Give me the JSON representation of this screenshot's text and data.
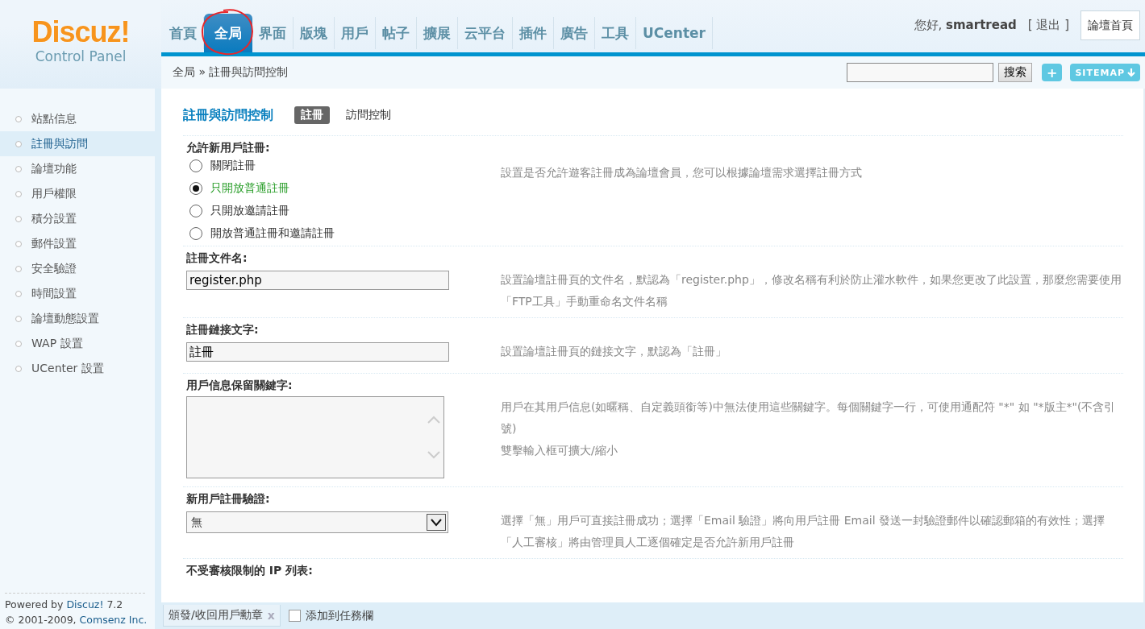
{
  "logo": {
    "name": "Discuz!",
    "subtitle": "Control Panel"
  },
  "nav": [
    {
      "label": "首頁",
      "selected": false
    },
    {
      "label": "全局",
      "selected": true
    },
    {
      "label": "界面",
      "selected": false
    },
    {
      "label": "版塊",
      "selected": false
    },
    {
      "label": "用戶",
      "selected": false
    },
    {
      "label": "帖子",
      "selected": false
    },
    {
      "label": "擴展",
      "selected": false
    },
    {
      "label": "云平台",
      "selected": false
    },
    {
      "label": "插件",
      "selected": false
    },
    {
      "label": "廣告",
      "selected": false
    },
    {
      "label": "工具",
      "selected": false
    },
    {
      "label": "UCenter",
      "selected": false
    }
  ],
  "user": {
    "greeting": "您好, **smartread**",
    "logout": "[ 退出 ]",
    "home_button": "論壇首頁"
  },
  "breadcrumb": {
    "section": "全局",
    "separator": "»",
    "page": "註冊與訪問控制"
  },
  "search": {
    "button": "搜索",
    "add_button": "+",
    "sitemap_button": "SITEMAP"
  },
  "sidebar": {
    "items": [
      {
        "label": "站點信息",
        "selected": false
      },
      {
        "label": "註冊與訪問",
        "selected": true
      },
      {
        "label": "論壇功能",
        "selected": false
      },
      {
        "label": "用戶權限",
        "selected": false
      },
      {
        "label": "積分設置",
        "selected": false
      },
      {
        "label": "郵件設置",
        "selected": false
      },
      {
        "label": "安全驗證",
        "selected": false
      },
      {
        "label": "時間設置",
        "selected": false
      },
      {
        "label": "論壇動態設置",
        "selected": false
      },
      {
        "label": "WAP 設置",
        "selected": false
      },
      {
        "label": "UCenter 設置",
        "selected": false
      }
    ],
    "footer": {
      "powered": "Powered by",
      "product": "Discuz!",
      "version": "7.2",
      "copyright": "© 2001-2009,",
      "company": "Comsenz Inc."
    }
  },
  "page": {
    "title": "註冊與訪問控制",
    "tabs": [
      {
        "label": "註冊",
        "selected": true
      },
      {
        "label": "訪問控制",
        "selected": false
      }
    ]
  },
  "sections": [
    {
      "kind": "radio",
      "label": "允許新用戶註冊:",
      "options": [
        {
          "label": "關閉註冊",
          "selected": false
        },
        {
          "label": "只開放普通註冊",
          "selected": true
        },
        {
          "label": "只開放邀請註冊",
          "selected": false
        },
        {
          "label": "開放普通註冊和邀請註冊",
          "selected": false
        }
      ],
      "description": [
        "設置是否允許遊客註冊成為論壇會員，您可以根據論壇需求選擇註冊方式"
      ]
    },
    {
      "kind": "text",
      "label": "註冊文件名:",
      "value": "register.php",
      "description": [
        "設置論壇註冊頁的文件名，默認為「register.php」，修改名稱有利於防止灌水軟件，如果您更改了此設置，那麼您需要使用「FTP工具」手動重命名文件名稱"
      ]
    },
    {
      "kind": "text",
      "label": "註冊鏈接文字:",
      "value": "註冊",
      "description": [
        "設置論壇註冊頁的鏈接文字，默認為「註冊」"
      ]
    },
    {
      "kind": "textarea",
      "label": "用戶信息保留關鍵字:",
      "description": [
        "用戶在其用戶信息(如暱稱、自定義頭銜等)中無法使用這些關鍵字。每個關鍵字一行，可使用通配符 \"*\" 如 \"*版主*\"(不含引號)",
        "雙擊輸入框可擴大/縮小"
      ]
    },
    {
      "kind": "select",
      "label": "新用戶註冊驗證:",
      "value": "無",
      "description": [
        "選擇「無」用戶可直接註冊成功；選擇「Email 驗證」將向用戶註冊 Email 發送一封驗證郵件以確認郵箱的有效性；選擇「人工審核」將由管理員人工逐個確定是否允許新用戶註冊"
      ]
    },
    {
      "kind": "heading",
      "label": "不受審核限制的 IP 列表:"
    }
  ],
  "taskbar": {
    "items": [
      {
        "label": "頒發/收回用戶勳章",
        "close": "x"
      }
    ],
    "add": "添加到任務欄"
  }
}
